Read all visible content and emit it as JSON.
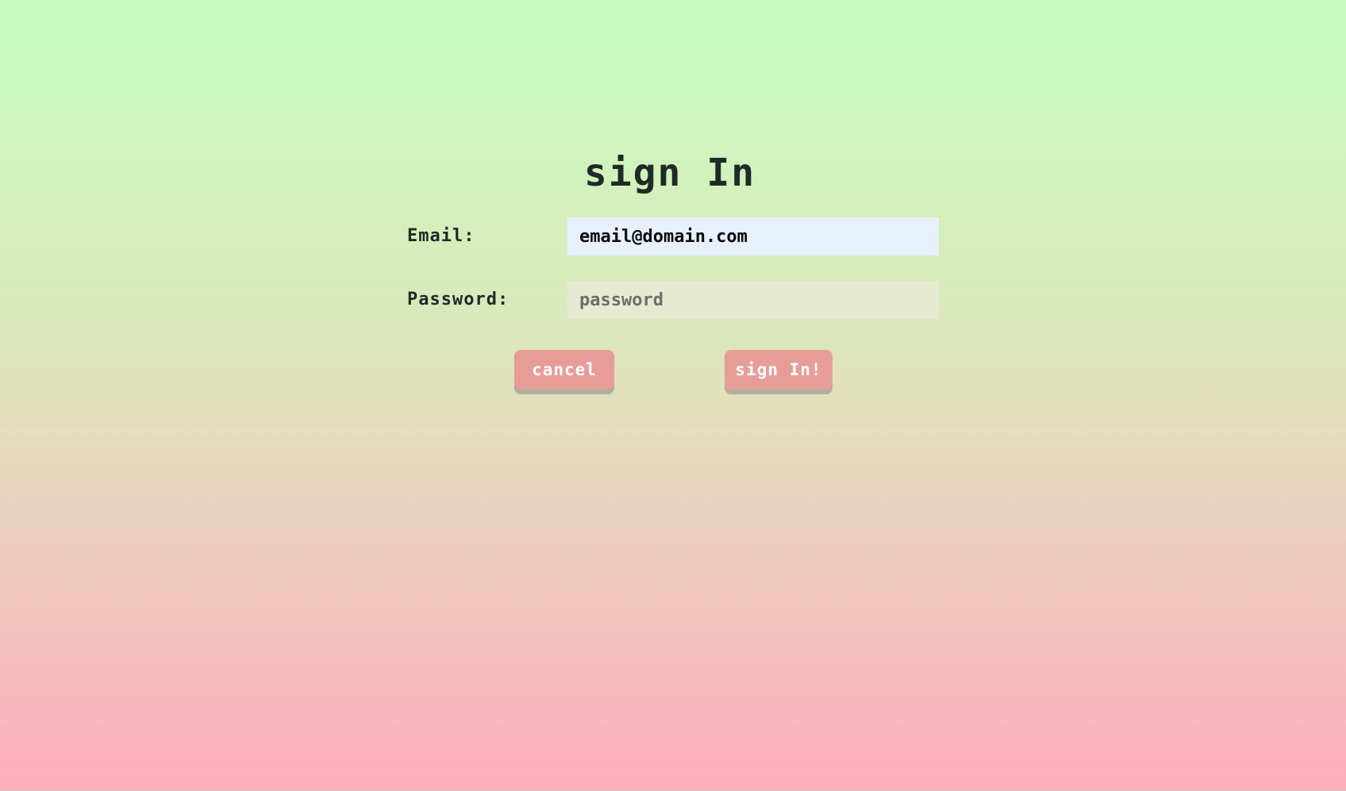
{
  "page": {
    "title": "sign In"
  },
  "form": {
    "email": {
      "label": "Email:",
      "value": "email@domain.com"
    },
    "password": {
      "label": "Password:",
      "placeholder": "password",
      "value": ""
    }
  },
  "actions": {
    "cancel_label": "cancel",
    "signin_label": "sign In!"
  },
  "colors": {
    "background_top": "#c6ffbd",
    "background_bottom": "#ffadbc",
    "button": "#e69d98",
    "button_shadow": "#b4ae9c",
    "text": "#1f2a26"
  }
}
